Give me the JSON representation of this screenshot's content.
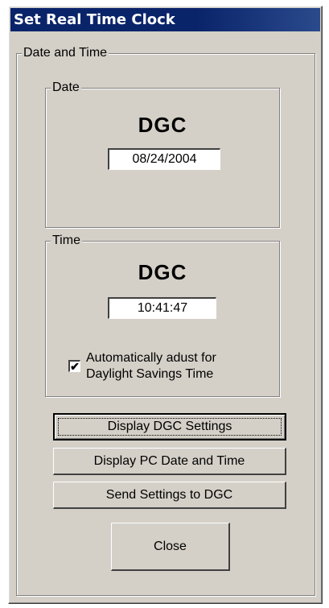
{
  "window": {
    "title": "Set Real Time Clock"
  },
  "date_time_group": {
    "legend": "Date and Time",
    "date": {
      "legend": "Date",
      "device_label": "DGC",
      "value": "08/24/2004"
    },
    "time": {
      "legend": "Time",
      "device_label": "DGC",
      "value": "10:41:47",
      "dst_checkbox": {
        "checked": true,
        "label_line1": "Automatically adust for",
        "label_line2": "Daylight Savings Time"
      }
    }
  },
  "buttons": {
    "display_dgc": "Display DGC Settings",
    "display_pc": "Display PC Date and Time",
    "send": "Send Settings to DGC",
    "close": "Close"
  }
}
